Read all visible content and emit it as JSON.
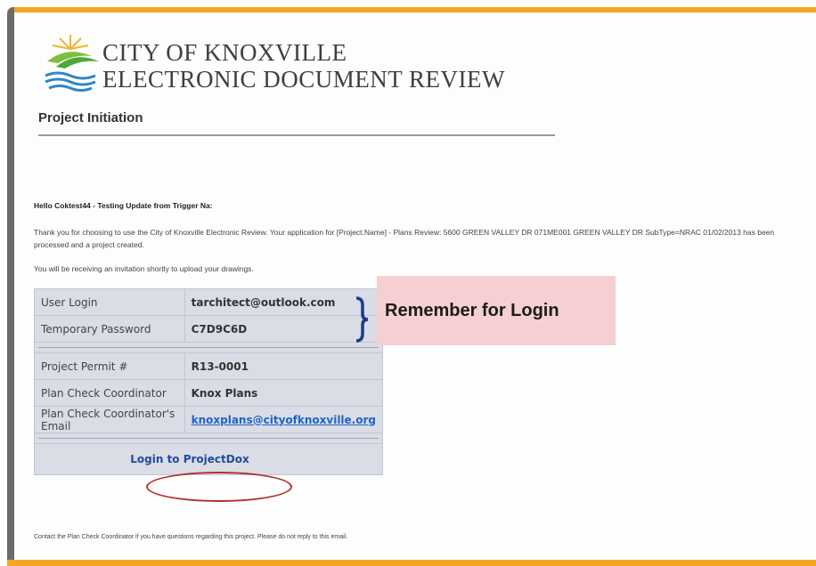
{
  "brand": {
    "line1": "CITY OF KNOXVILLE",
    "line2": "ELECTRONIC DOCUMENT REVIEW"
  },
  "page_title": "Project Initiation",
  "email": {
    "greeting": "Hello Coktest44 - Testing Update from Trigger Na:",
    "paragraph1": "Thank you for choosing to use the City of Knoxville Electronic Review. Your application for [Project.Name] - Plans Review: 5600 GREEN VALLEY DR 071ME001 GREEN VALLEY DR SubType=NRAC 01/02/2013 has been processed and a project created.",
    "paragraph2": "You will be receiving an invitation shortly to upload your drawings.",
    "footer": "Contact the Plan Check Coordinator if you have questions regarding this project. Please do not reply to this email."
  },
  "info_table": {
    "user_login_label": "User Login",
    "user_login_value": "tarchitect@outlook.com",
    "temp_password_label": "Temporary Password",
    "temp_password_value": "C7D9C6D",
    "permit_label": "Project Permit #",
    "permit_value": "R13-0001",
    "coordinator_label": "Plan Check Coordinator",
    "coordinator_value": "Knox Plans",
    "coordinator_email_label": "Plan Check Coordinator's Email",
    "coordinator_email_value": "knoxplans@cityofknoxville.org",
    "login_link": "Login to ProjectDox"
  },
  "callout": {
    "text": "Remember for Login"
  },
  "colors": {
    "frame_accent": "#f5a623",
    "callout_bg": "#f5cfd1",
    "table_bg": "#dadce6",
    "link": "#1f64c6",
    "oval": "#b13232"
  }
}
